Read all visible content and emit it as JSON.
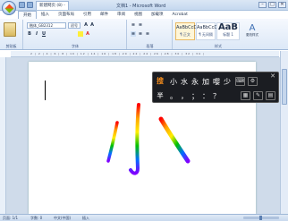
{
  "window": {
    "title": "文档1 - Microsoft Word",
    "doc_tab": "新建网页 (8) -",
    "min": "–",
    "max": "□",
    "close": "✕"
  },
  "tabs": [
    "开始",
    "插入",
    "页面布局",
    "引用",
    "邮件",
    "审阅",
    "视图",
    "加载项",
    "Acrobat"
  ],
  "ribbon": {
    "font_name": "楷体_GB2312",
    "font_size": "初号",
    "bold": "B",
    "italic": "I",
    "underline": "U",
    "groups": {
      "clipboard": "剪贴板",
      "font": "字体",
      "paragraph": "段落",
      "styles": "样式"
    },
    "styles": [
      {
        "sample": "AaBbCcD",
        "name": "¶ 正文"
      },
      {
        "sample": "AaBbCcD",
        "name": "¶ 无间隔"
      },
      {
        "sample": "AaB",
        "name": "标题 1"
      }
    ],
    "change_styles": "更改样式"
  },
  "ruler_marks": "2 | 2 | 4 | 6 | 8 | 10 | 12 | 14 | 16 | 18 | 20 | 22 | 24 | 26 | 28 | 30 | 32 | 34 |",
  "ime": {
    "logo": "搜",
    "candidates": [
      "小",
      "水",
      "永",
      "加",
      "嘤",
      "少"
    ],
    "symbols": [
      "。",
      "，",
      "；",
      "：",
      "？"
    ],
    "close": "✕"
  },
  "handwriting": {
    "character": "小",
    "colors": [
      "#ff0000",
      "#ffa500",
      "#ffee00",
      "#00c000",
      "#0070ff",
      "#8000ff"
    ]
  },
  "status": {
    "page": "页面: 1/1",
    "words": "字数: 0",
    "language": "中文(中国)",
    "mode": "插入"
  }
}
